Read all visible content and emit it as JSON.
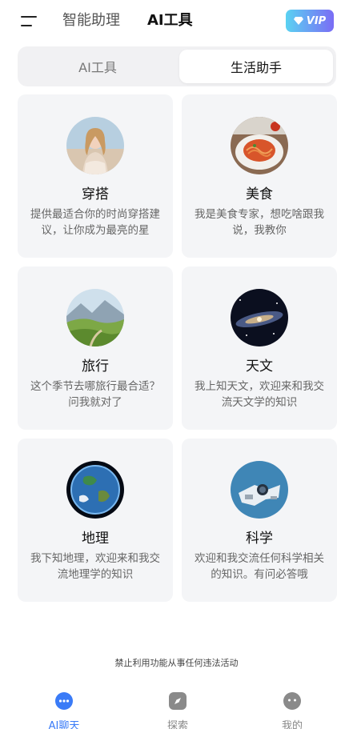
{
  "header": {
    "tabs": [
      {
        "label": "智能助理",
        "active": false
      },
      {
        "label": "AI工具",
        "active": true
      }
    ],
    "vip_label": "VIP"
  },
  "segment": {
    "items": [
      {
        "label": "AI工具",
        "selected": false
      },
      {
        "label": "生活助手",
        "selected": true
      }
    ]
  },
  "cards": [
    {
      "title": "穿搭",
      "desc": "提供最适合你的时尚穿搭建议，让你成为最亮的星",
      "icon": "fashion-girl-avatar"
    },
    {
      "title": "美食",
      "desc": "我是美食专家，想吃啥跟我说，我教你",
      "icon": "pasta-avatar"
    },
    {
      "title": "旅行",
      "desc": "这个季节去哪旅行最合适？问我就对了",
      "icon": "mountain-landscape-avatar"
    },
    {
      "title": "天文",
      "desc": "我上知天文，欢迎来和我交流天文学的知识",
      "icon": "galaxy-avatar"
    },
    {
      "title": "地理",
      "desc": "我下知地理，欢迎来和我交流地理学的知识",
      "icon": "earth-avatar"
    },
    {
      "title": "科学",
      "desc": "欢迎和我交流任何科学相关的知识。有问必答哦",
      "icon": "astronaut-avatar"
    }
  ],
  "notice": "禁止利用功能从事任何违法活动",
  "tabbar": {
    "items": [
      {
        "label": "AI聊天",
        "active": true
      },
      {
        "label": "探索",
        "active": false
      },
      {
        "label": "我的",
        "active": false
      }
    ]
  },
  "colors": {
    "accent": "#3a7bf7",
    "card_bg": "#f4f5f7",
    "vip_start": "#5ad2f2",
    "vip_end": "#7a6cf5"
  }
}
